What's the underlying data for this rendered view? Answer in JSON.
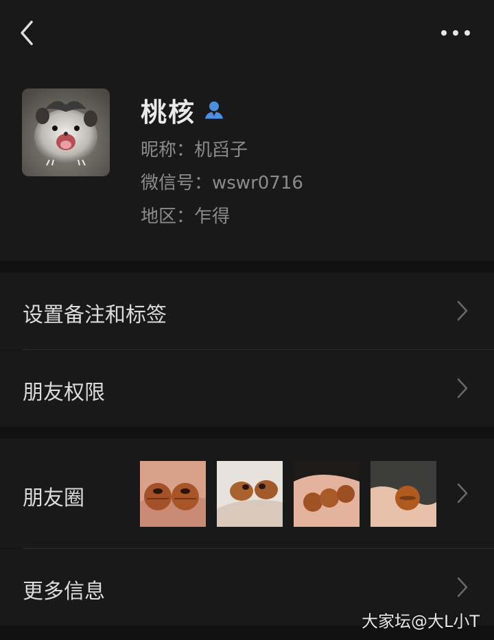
{
  "header": {
    "back_icon": "chevron-left-icon",
    "more_icon": "more-horizontal-icon"
  },
  "profile": {
    "avatar_desc_icon": "avatar",
    "name": "桃核",
    "contact_icon": "person-icon",
    "nickname": "昵称：机舀子",
    "wechat_id": "微信号：wswr0716",
    "region": "地区：乍得"
  },
  "menu": {
    "remark_tags": "设置备注和标签",
    "friend_permissions": "朋友权限",
    "moments": "朋友圈",
    "more_info": "更多信息"
  },
  "watermark": "大家坛@大L小T",
  "colors": {
    "background": "#111111",
    "panel": "#191919",
    "accent": "#4c8fe0"
  }
}
